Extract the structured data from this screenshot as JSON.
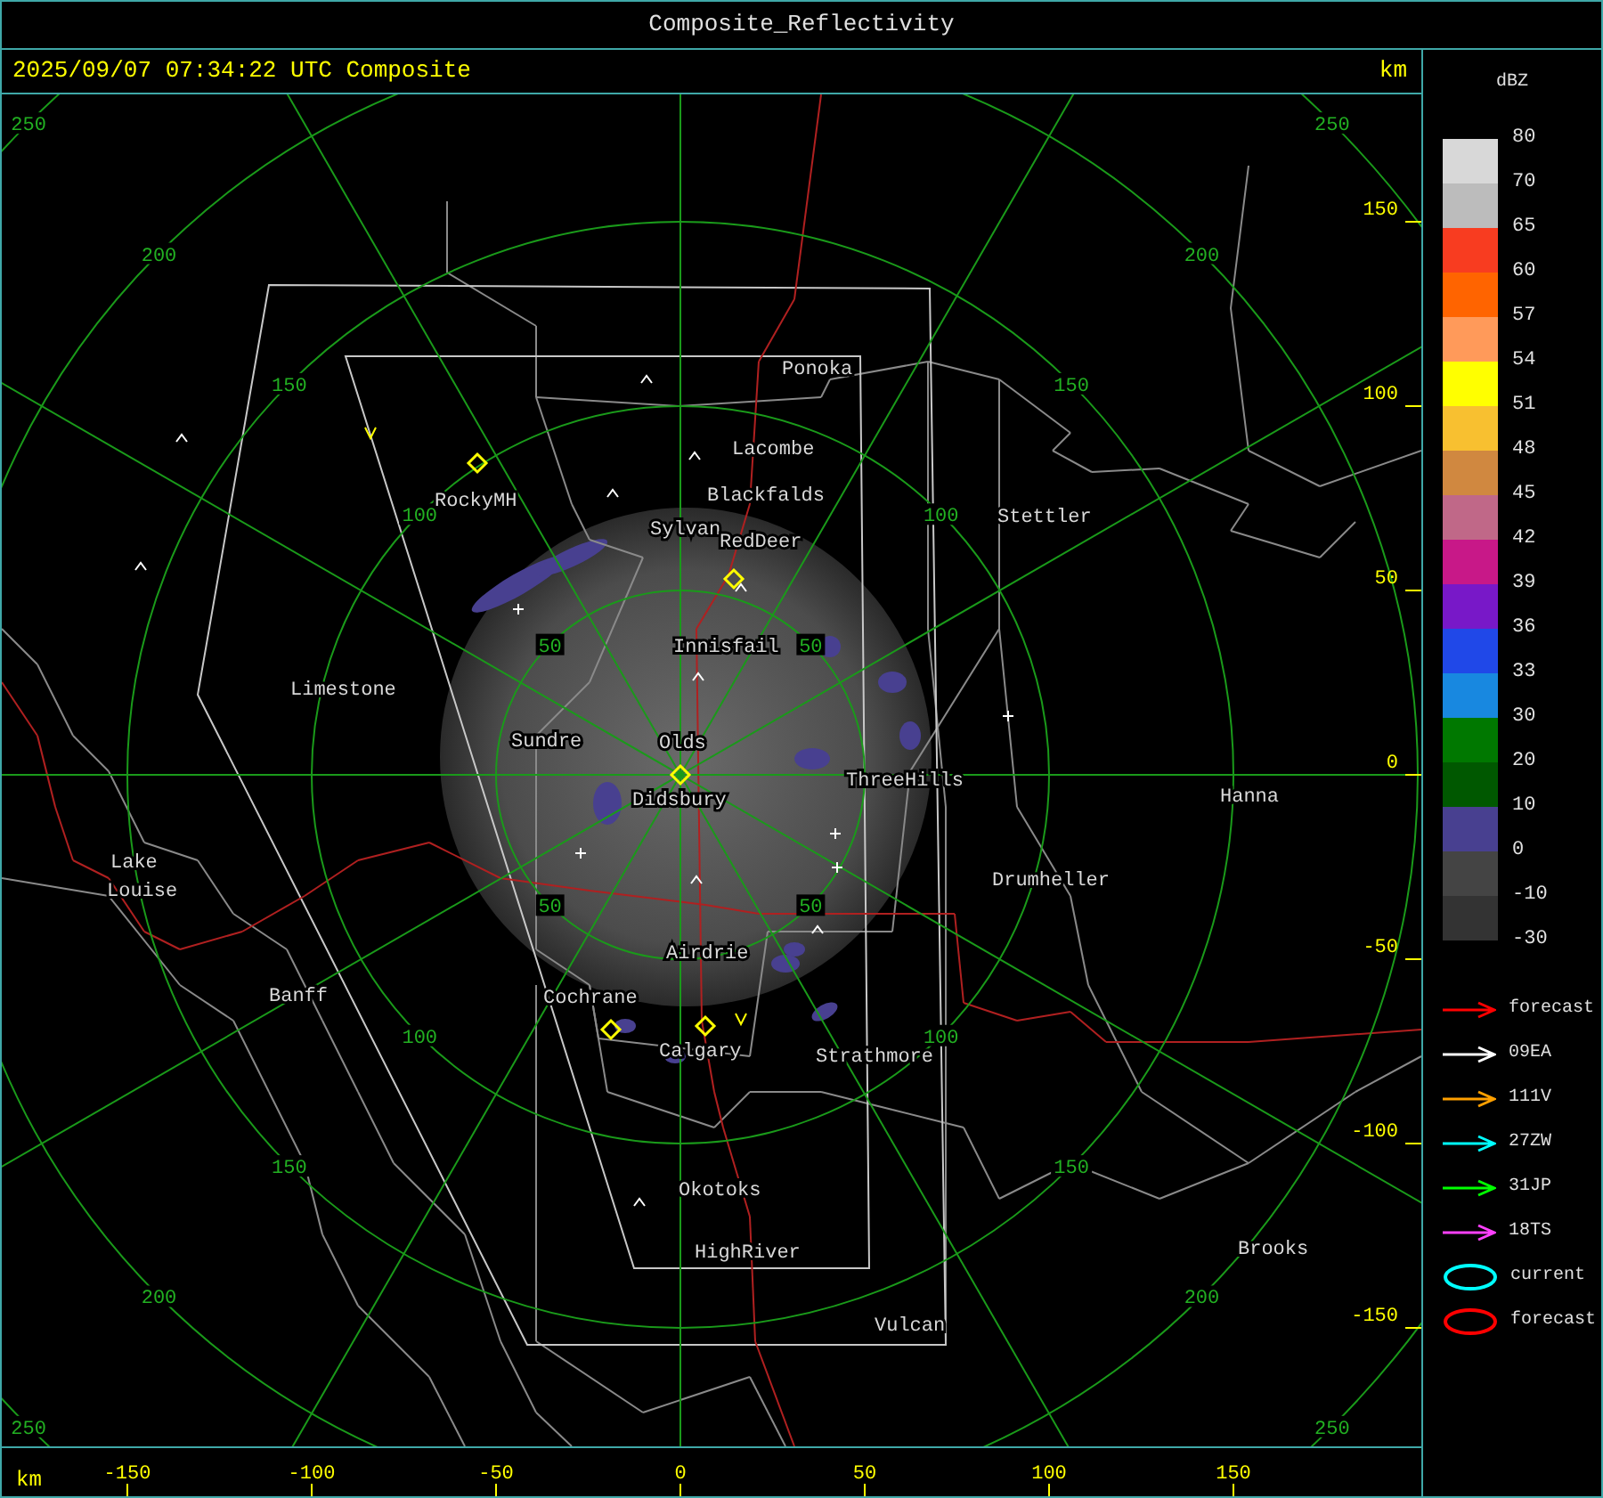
{
  "window": {
    "title": "Composite_Reflectivity"
  },
  "header": {
    "timestamp": "2025/09/07 07:34:22 UTC Composite",
    "unit": "km"
  },
  "map": {
    "range_rings": [
      {
        "labels": [
          "50",
          "50",
          "50",
          "50"
        ]
      },
      {
        "labels": [
          "100",
          "100",
          "100",
          "100"
        ]
      },
      {
        "labels": [
          "150",
          "150",
          "150",
          "150"
        ]
      },
      {
        "labels": [
          "200",
          "200",
          "200",
          "200"
        ]
      },
      {
        "labels": [
          "250",
          "250",
          "250",
          "250"
        ]
      }
    ],
    "y_ticks": [
      "150",
      "100",
      "50",
      "0",
      "-50",
      "-100",
      "-150"
    ],
    "x_ticks": [
      "-150",
      "-100",
      "-50",
      "0",
      "50",
      "100",
      "150"
    ],
    "x_unit": "km",
    "places": [
      {
        "name": "Ponoka"
      },
      {
        "name": "Lacombe"
      },
      {
        "name": "Blackfalds"
      },
      {
        "name": "Sylvan"
      },
      {
        "name": "RedDeer"
      },
      {
        "name": "RockyMH"
      },
      {
        "name": "Stettler"
      },
      {
        "name": "Innisfail"
      },
      {
        "name": "Limestone"
      },
      {
        "name": "Sundre"
      },
      {
        "name": "Olds"
      },
      {
        "name": "ThreeHills"
      },
      {
        "name": "Didsbury"
      },
      {
        "name": "Hanna"
      },
      {
        "name": "Drumheller"
      },
      {
        "name": "Lake Louise"
      },
      {
        "name": "Banff"
      },
      {
        "name": "Airdrie"
      },
      {
        "name": "Cochrane"
      },
      {
        "name": "Calgary"
      },
      {
        "name": "Strathmore"
      },
      {
        "name": "Okotoks"
      },
      {
        "name": "HighRiver"
      },
      {
        "name": "Vulcan"
      },
      {
        "name": "Brooks"
      }
    ]
  },
  "legend": {
    "unit": "dBZ",
    "scale": [
      {
        "label": "80",
        "color": "#d8d8d8"
      },
      {
        "label": "70",
        "color": "#bcbcbc"
      },
      {
        "label": "65",
        "color": "#f83c20"
      },
      {
        "label": "60",
        "color": "#ff6400"
      },
      {
        "label": "57",
        "color": "#ff9a5a"
      },
      {
        "label": "54",
        "color": "#ffff00"
      },
      {
        "label": "51",
        "color": "#f8c030"
      },
      {
        "label": "48",
        "color": "#d08840"
      },
      {
        "label": "45",
        "color": "#c06888"
      },
      {
        "label": "42",
        "color": "#c81888"
      },
      {
        "label": "39",
        "color": "#7818c8"
      },
      {
        "label": "36",
        "color": "#2048e8"
      },
      {
        "label": "33",
        "color": "#1888e0"
      },
      {
        "label": "30",
        "color": "#007800"
      },
      {
        "label": "20",
        "color": "#005800"
      },
      {
        "label": "10",
        "color": "#484090"
      },
      {
        "label": "0",
        "color": "#444444"
      },
      {
        "label": "-10",
        "color": "#333333"
      },
      {
        "label": "-30"
      }
    ],
    "tracks": [
      {
        "kind": "arrow",
        "label": "forecast",
        "color": "#ff0000"
      },
      {
        "kind": "arrow",
        "label": "09EA",
        "color": "#ffffff"
      },
      {
        "kind": "arrow",
        "label": "111V",
        "color": "#ffa000"
      },
      {
        "kind": "arrow",
        "label": "27ZW",
        "color": "#00ffff"
      },
      {
        "kind": "arrow",
        "label": "31JP",
        "color": "#00ff00"
      },
      {
        "kind": "arrow",
        "label": "18TS",
        "color": "#ff40ff"
      },
      {
        "kind": "ellipse",
        "label": "current",
        "color": "#00ffff"
      },
      {
        "kind": "ellipse",
        "label": "forecast",
        "color": "#ff0000"
      }
    ]
  }
}
